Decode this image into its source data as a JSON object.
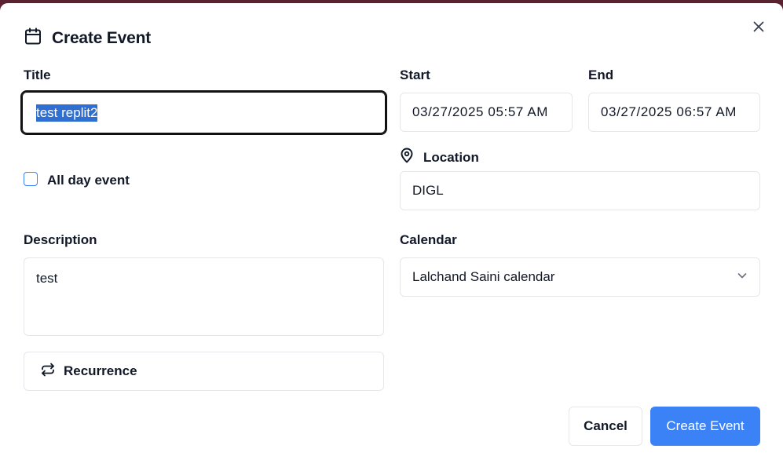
{
  "dialog": {
    "title": "Create Event",
    "title_label": "Title",
    "title_value_selected": "test replit2",
    "start_label": "Start",
    "start_value": "03/27/2025 05:57 AM",
    "end_label": "End",
    "end_value": "03/27/2025 06:57 AM",
    "all_day_label": "All day event",
    "all_day_checked": false,
    "location_label": "Location",
    "location_value": "DIGL",
    "description_label": "Description",
    "description_value": "test",
    "calendar_label": "Calendar",
    "calendar_value": "Lalchand Saini calendar",
    "recurrence_label": "Recurrence",
    "cancel_label": "Cancel",
    "create_label": "Create Event"
  },
  "icons": {
    "header": "calendar-icon",
    "close": "close-icon",
    "location": "map-pin-icon",
    "recurrence": "repeat-icon",
    "dropdown": "chevron-down-icon"
  },
  "colors": {
    "primary": "#3b82f6",
    "selection": "#2f6fd1",
    "border": "#e5e7eb",
    "backdrop": "#5a2130"
  }
}
